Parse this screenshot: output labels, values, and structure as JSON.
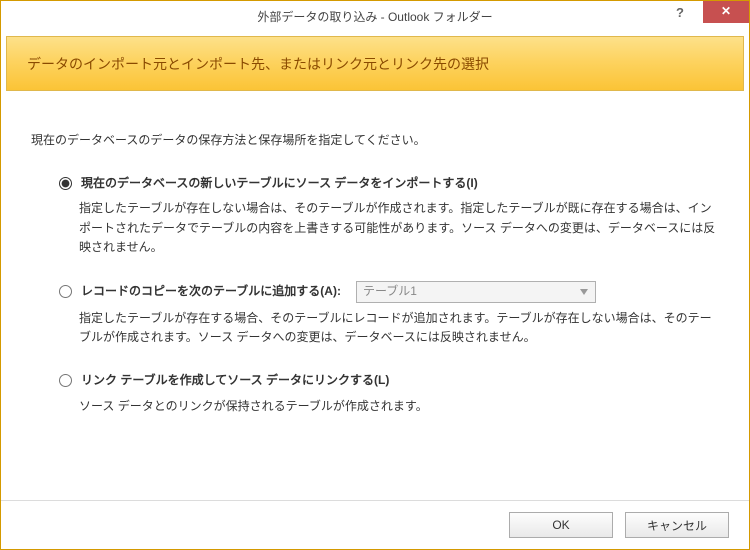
{
  "title": "外部データの取り込み - Outlook フォルダー",
  "header": "データのインポート元とインポート先、またはリンク元とリンク先の選択",
  "intro": "現在のデータベースのデータの保存方法と保存場所を指定してください。",
  "options": {
    "opt1": {
      "label": "現在のデータベースの新しいテーブルにソース データをインポートする(I)",
      "desc": "指定したテーブルが存在しない場合は、そのテーブルが作成されます。指定したテーブルが既に存在する場合は、インポートされたデータでテーブルの内容を上書きする可能性があります。ソース データへの変更は、データベースには反映されません。",
      "selected": true
    },
    "opt2": {
      "label": "レコードのコピーを次のテーブルに追加する(A):",
      "desc": "指定したテーブルが存在する場合、そのテーブルにレコードが追加されます。テーブルが存在しない場合は、そのテーブルが作成されます。ソース データへの変更は、データベースには反映されません。",
      "combo_value": "テーブル1",
      "selected": false
    },
    "opt3": {
      "label": "リンク テーブルを作成してソース データにリンクする(L)",
      "desc": "ソース データとのリンクが保持されるテーブルが作成されます。",
      "selected": false
    }
  },
  "footer": {
    "ok": "OK",
    "cancel": "キャンセル"
  },
  "titlebar": {
    "help": "?",
    "close": "✕"
  }
}
